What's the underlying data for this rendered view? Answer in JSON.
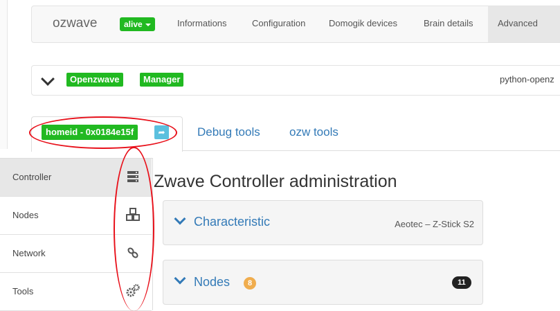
{
  "navbar": {
    "brand": "ozwave",
    "status_label": "alive",
    "links": [
      "Informations",
      "Configuration",
      "Domogik devices",
      "Brain details",
      "Advanced"
    ]
  },
  "plugin_bar": {
    "labels": [
      "Openzwave",
      "Manager"
    ],
    "right_text": "python-openz"
  },
  "tabs": {
    "homeid_label": "homeid - 0x0184e15f",
    "items": [
      "Debug tools",
      "ozw tools"
    ]
  },
  "sidebar": {
    "items": [
      {
        "label": "Controller",
        "icon": "server-icon"
      },
      {
        "label": "Nodes",
        "icon": "cubes-icon"
      },
      {
        "label": "Network",
        "icon": "link-icon"
      },
      {
        "label": "Tools",
        "icon": "cogs-icon"
      }
    ]
  },
  "main": {
    "title": "Zwave Controller administration",
    "panels": [
      {
        "title": "Characteristic",
        "right_text": "Aeotec – Z-Stick S2"
      },
      {
        "title": "Nodes",
        "badge": "8",
        "count": "11"
      }
    ]
  },
  "colors": {
    "success": "#21b921",
    "link": "#337ab7",
    "annotation": "#e8101a",
    "badge_warning": "#f0ad4e"
  }
}
